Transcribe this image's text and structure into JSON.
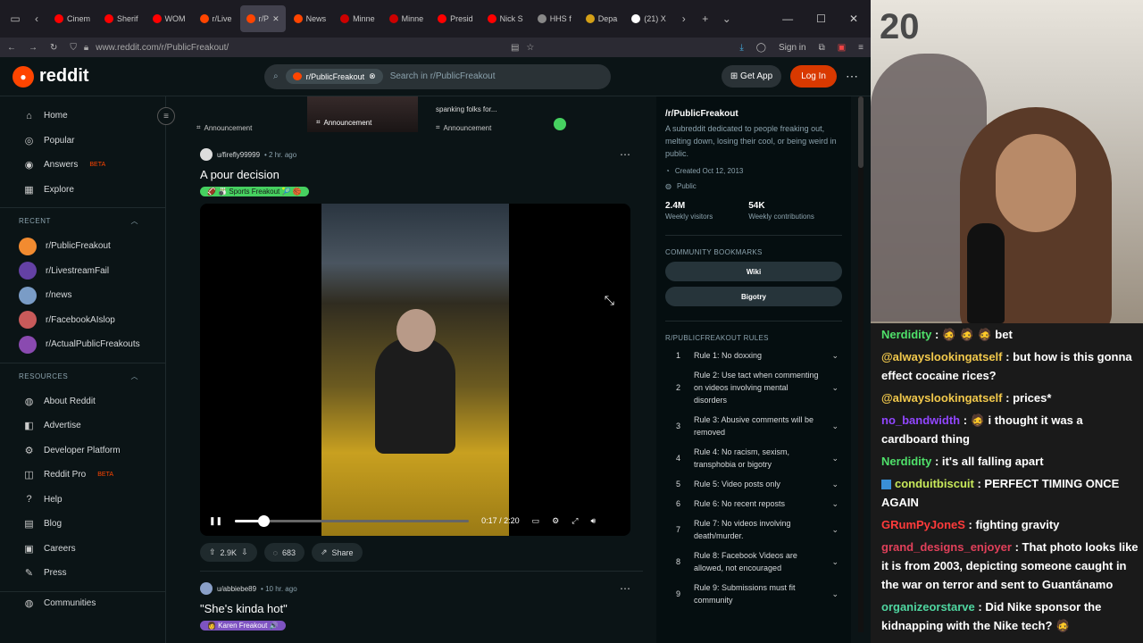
{
  "browser": {
    "tabs": [
      {
        "label": "Cinem",
        "color": "#ff0000"
      },
      {
        "label": "Sherif",
        "color": "#ff0000"
      },
      {
        "label": "WOM",
        "color": "#ff0000"
      },
      {
        "label": "r/Live",
        "color": "#ff4500"
      },
      {
        "label": "r/P",
        "color": "#ff4500",
        "active": true
      },
      {
        "label": "News",
        "color": "#ff4500"
      },
      {
        "label": "Minne",
        "color": "#cc0000"
      },
      {
        "label": "Minne",
        "color": "#cc0000"
      },
      {
        "label": "Presid",
        "color": "#ff0000"
      },
      {
        "label": "Nick S",
        "color": "#ff0000"
      },
      {
        "label": "HHS f",
        "color": "#888888"
      },
      {
        "label": "Depa",
        "color": "#d4a017"
      },
      {
        "label": "(21) X",
        "color": "#ffffff"
      }
    ],
    "url": "www.reddit.com/r/PublicFreakout/",
    "sign_in": "Sign in"
  },
  "header": {
    "logo": "reddit",
    "search_chip": "r/PublicFreakout",
    "search_placeholder": "Search in r/PublicFreakout",
    "get_app": "Get App",
    "log_in": "Log In"
  },
  "sidebar": {
    "main": [
      {
        "label": "Home",
        "icon": "home-icon",
        "glyph": "⌂"
      },
      {
        "label": "Popular",
        "icon": "popular-icon",
        "glyph": "◎"
      },
      {
        "label": "Answers",
        "icon": "answers-icon",
        "glyph": "◉",
        "beta": "BETA"
      },
      {
        "label": "Explore",
        "icon": "explore-icon",
        "glyph": "▦"
      }
    ],
    "recent_title": "RECENT",
    "recent": [
      {
        "label": "r/PublicFreakout",
        "color": "#f28b30"
      },
      {
        "label": "r/LivestreamFail",
        "color": "#6441a5"
      },
      {
        "label": "r/news",
        "color": "#7a9cc6"
      },
      {
        "label": "r/FacebookAIslop",
        "color": "#c85a5a"
      },
      {
        "label": "r/ActualPublicFreakouts",
        "color": "#8a4ab0"
      }
    ],
    "resources_title": "RESOURCES",
    "resources": [
      {
        "label": "About Reddit",
        "icon": "about-icon",
        "glyph": "◍"
      },
      {
        "label": "Advertise",
        "icon": "advertise-icon",
        "glyph": "◧"
      },
      {
        "label": "Developer Platform",
        "icon": "developer-icon",
        "glyph": "⚙"
      },
      {
        "label": "Reddit Pro",
        "icon": "reddit-pro-icon",
        "glyph": "◫",
        "beta": "BETA"
      },
      {
        "label": "Help",
        "icon": "help-icon",
        "glyph": "?"
      },
      {
        "label": "Blog",
        "icon": "blog-icon",
        "glyph": "▤"
      },
      {
        "label": "Careers",
        "icon": "careers-icon",
        "glyph": "▣"
      },
      {
        "label": "Press",
        "icon": "press-icon",
        "glyph": "✎"
      }
    ],
    "communities": "Communities"
  },
  "feed": {
    "announcements": [
      {
        "label": "Announcement"
      },
      {
        "label": "Announcement",
        "img": true
      },
      {
        "label": "Announcement"
      }
    ],
    "ann_snippet": "spanking folks for...",
    "post1": {
      "user": "u/firefly99999",
      "time": "• 2 hr. ago",
      "title": "A pour decision",
      "flair": "🏈 🎳 Sports Freakout 🎾 🏀",
      "video_time": "0:17 / 2:20",
      "progress": 0.12,
      "upvotes": "2.9K",
      "comments": "683",
      "share": "Share"
    },
    "post2": {
      "user": "u/abbiebe89",
      "time": "• 10 hr. ago",
      "title": "\"She's kinda hot\"",
      "flair": "👩 Karen Freakout 🔊"
    }
  },
  "community": {
    "name": "/r/PublicFreakout",
    "description": "A subreddit dedicated to people freaking out, melting down, losing their cool, or being weird in public.",
    "created": "Created Oct 12, 2013",
    "visibility": "Public",
    "visitors": "2.4M",
    "visitors_label": "Weekly visitors",
    "contributions": "54K",
    "contributions_label": "Weekly contributions",
    "bookmarks_title": "COMMUNITY BOOKMARKS",
    "bookmarks": [
      "Wiki",
      "Bigotry"
    ],
    "rules_title": "R/PUBLICFREAKOUT RULES",
    "rules": [
      {
        "num": "1",
        "text": "Rule 1: No doxxing"
      },
      {
        "num": "2",
        "text": "Rule 2: Use tact when commenting on videos involving mental disorders"
      },
      {
        "num": "3",
        "text": "Rule 3: Abusive comments will be removed"
      },
      {
        "num": "4",
        "text": "Rule 4: No racism, sexism, transphobia or bigotry"
      },
      {
        "num": "5",
        "text": "Rule 5: Video posts only"
      },
      {
        "num": "6",
        "text": "Rule 6: No recent reposts"
      },
      {
        "num": "7",
        "text": "Rule 7: No videos involving death/murder."
      },
      {
        "num": "8",
        "text": "Rule 8: Facebook Videos are allowed, not encouraged"
      },
      {
        "num": "9",
        "text": "Rule 9: Submissions must fit community"
      }
    ]
  },
  "stream": {
    "corner_number": "20",
    "chat": [
      {
        "user": "Nerdidity",
        "color": "#4fe06a",
        "text": ": 🧔 🧔 🧔 bet"
      },
      {
        "user": "@alwayslookingatself",
        "color": "#f2c94c",
        "text": ": but how is this gonna effect cocaine rices?"
      },
      {
        "user": "@alwayslookingatself",
        "color": "#f2c94c",
        "text": ": prices*"
      },
      {
        "user": "no_bandwidth",
        "color": "#9146ff",
        "text": ": 🧔 i thought it was a cardboard thing"
      },
      {
        "user": "Nerdidity",
        "color": "#4fe06a",
        "text": ": it's all falling apart"
      },
      {
        "user": "conduitbiscuit",
        "color": "#c7e85a",
        "text": ": PERFECT TIMING ONCE AGAIN",
        "badge": true
      },
      {
        "user": "GRumPyJoneS",
        "color": "#ff3b3b",
        "text": ": fighting gravity"
      },
      {
        "user": "grand_designs_enjoyer",
        "color": "#e0405a",
        "text": ": That photo looks like it is from 2003, depicting someone caught in the war on terror and sent to Guantánamo"
      },
      {
        "user": "organizeorstarve",
        "color": "#4fd6a0",
        "text": ": Did Nike sponsor the kidnapping with the Nike tech? 🧔"
      }
    ]
  }
}
